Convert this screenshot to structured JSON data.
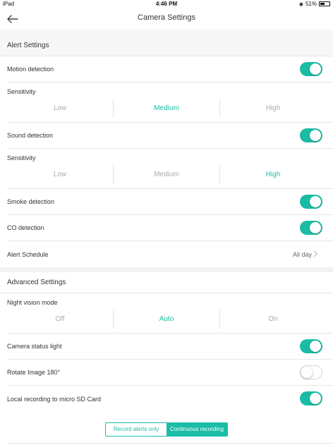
{
  "status_bar": {
    "device": "iPad",
    "time": "4:46 PM",
    "battery": "51%",
    "battery_level": 0.51
  },
  "nav": {
    "title": "Camera Settings"
  },
  "alert_settings": {
    "header": "Alert Settings",
    "motion": {
      "label": "Motion detection",
      "on": true
    },
    "motion_sensitivity": {
      "label": "Sensitivity",
      "options": [
        "Low",
        "Medium",
        "High"
      ],
      "selected": "Medium"
    },
    "sound": {
      "label": "Sound detection",
      "on": true
    },
    "sound_sensitivity": {
      "label": "Sensitivity",
      "options": [
        "Low",
        "Medium",
        "High"
      ],
      "selected": "High"
    },
    "smoke": {
      "label": "Smoke detection",
      "on": true
    },
    "co": {
      "label": "CO detection",
      "on": true
    },
    "schedule": {
      "label": "Alert Schedule",
      "value": "All day"
    }
  },
  "advanced_settings": {
    "header": "Advanced Settings",
    "night_vision": {
      "label": "Night vision mode",
      "options": [
        "Off",
        "Auto",
        "On"
      ],
      "selected": "Auto"
    },
    "status_light": {
      "label": "Camera status light",
      "on": true
    },
    "rotate": {
      "label": "Rotate Image 180°",
      "on": false
    },
    "local_recording": {
      "label": "Local recording to micro SD Card",
      "on": true
    },
    "recording_mode": {
      "options": [
        "Record alerts only",
        "Continuous recording"
      ],
      "selected": "Continuous recording"
    }
  },
  "colors": {
    "accent": "#1bbca5",
    "divider": "#e6e6e6",
    "section_bg": "#f7f7f7"
  }
}
